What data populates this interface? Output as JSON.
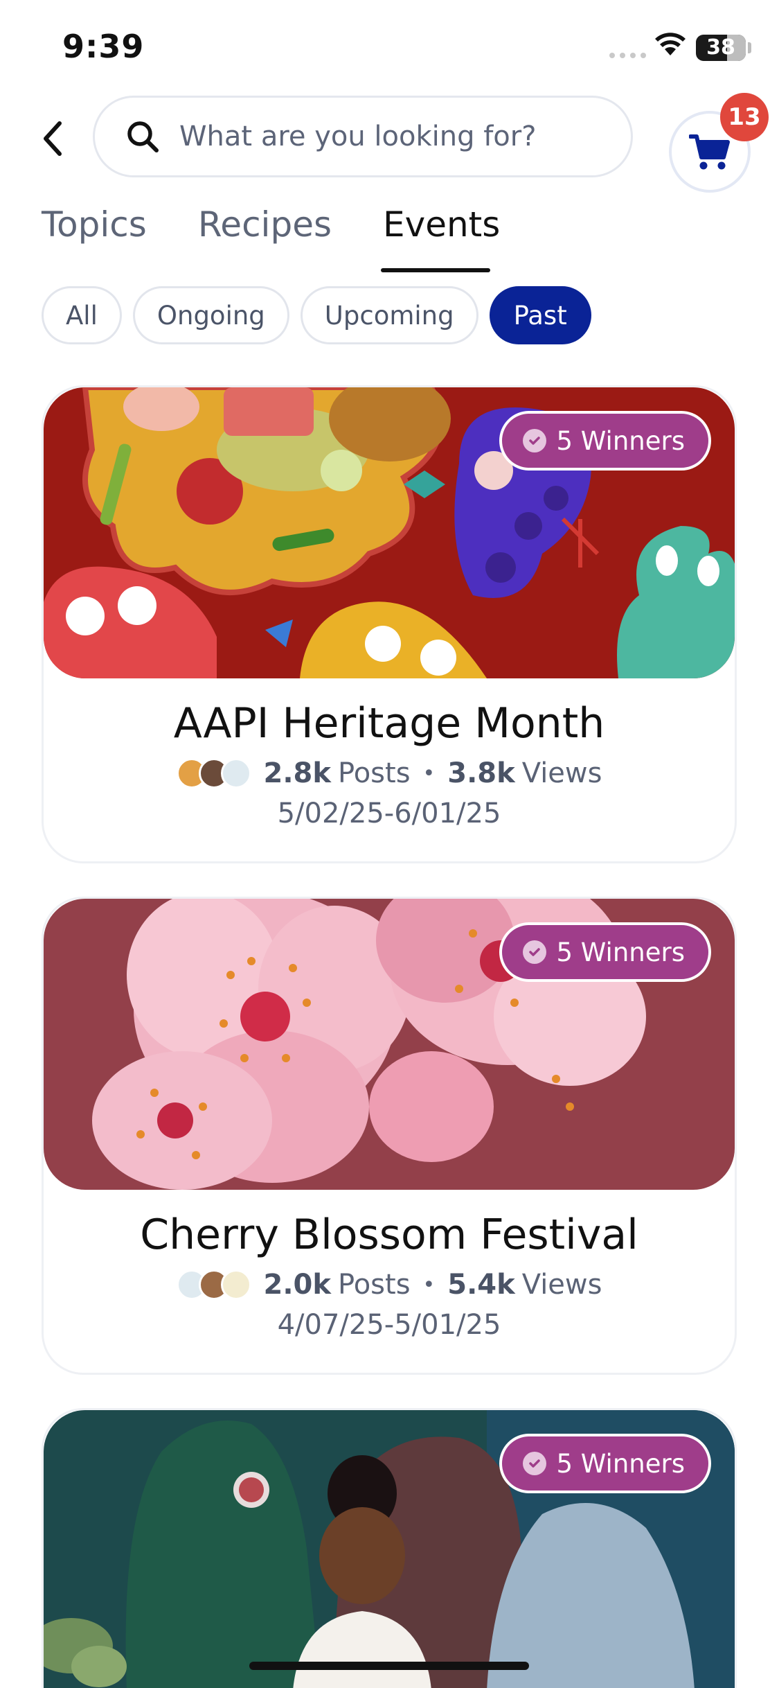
{
  "status_bar": {
    "time": "9:39",
    "battery": "38"
  },
  "search": {
    "placeholder": "What are you looking for?"
  },
  "cart": {
    "badge_count": "13"
  },
  "tabs": [
    {
      "label": "Topics",
      "active": false
    },
    {
      "label": "Recipes",
      "active": false
    },
    {
      "label": "Events",
      "active": true
    }
  ],
  "filters": [
    {
      "label": "All",
      "active": false
    },
    {
      "label": "Ongoing",
      "active": false
    },
    {
      "label": "Upcoming",
      "active": false
    },
    {
      "label": "Past",
      "active": true
    }
  ],
  "events": [
    {
      "title": "AAPI Heritage Month",
      "winners": "5 Winners",
      "posts_value": "2.8k",
      "posts_label": "Posts",
      "views_value": "3.8k",
      "views_label": "Views",
      "dates": "5/02/25-6/01/25"
    },
    {
      "title": "Cherry Blossom Festival",
      "winners": "5 Winners",
      "posts_value": "2.0k",
      "posts_label": "Posts",
      "views_value": "5.4k",
      "views_label": "Views",
      "dates": "4/07/25-5/01/25"
    },
    {
      "title": "",
      "winners": "5 Winners"
    }
  ],
  "colors": {
    "accent": "#0a2396",
    "badge": "#e0473c",
    "winners": "#9f3d8a"
  }
}
